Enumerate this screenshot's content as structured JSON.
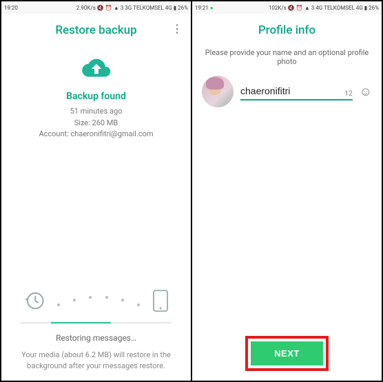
{
  "left": {
    "status": {
      "time": "19:20",
      "speed": "2.90K/s",
      "signal1": "3 3G",
      "carrier": "TELKOMSEL 4G",
      "battery": "26%"
    },
    "title": "Restore backup",
    "backup_found": "Backup found",
    "meta_time": "51 minutes ago",
    "meta_size": "Size: 260 MB",
    "meta_account": "Account: chaeronifitri@gmail.com",
    "status_text": "Restoring messages…",
    "footer": "Your media (about 6.2 MB) will restore in the background after your messages restore."
  },
  "right": {
    "status": {
      "time": "19:21",
      "speed": "102K/s",
      "signal1": "3 4G",
      "carrier": "TELKOMSEL 4G",
      "battery": "26%"
    },
    "title": "Profile info",
    "subtitle": "Please provide your name and an optional profile photo",
    "name_value": "chaeronifitri",
    "char_count": "12",
    "next_label": "NEXT"
  }
}
